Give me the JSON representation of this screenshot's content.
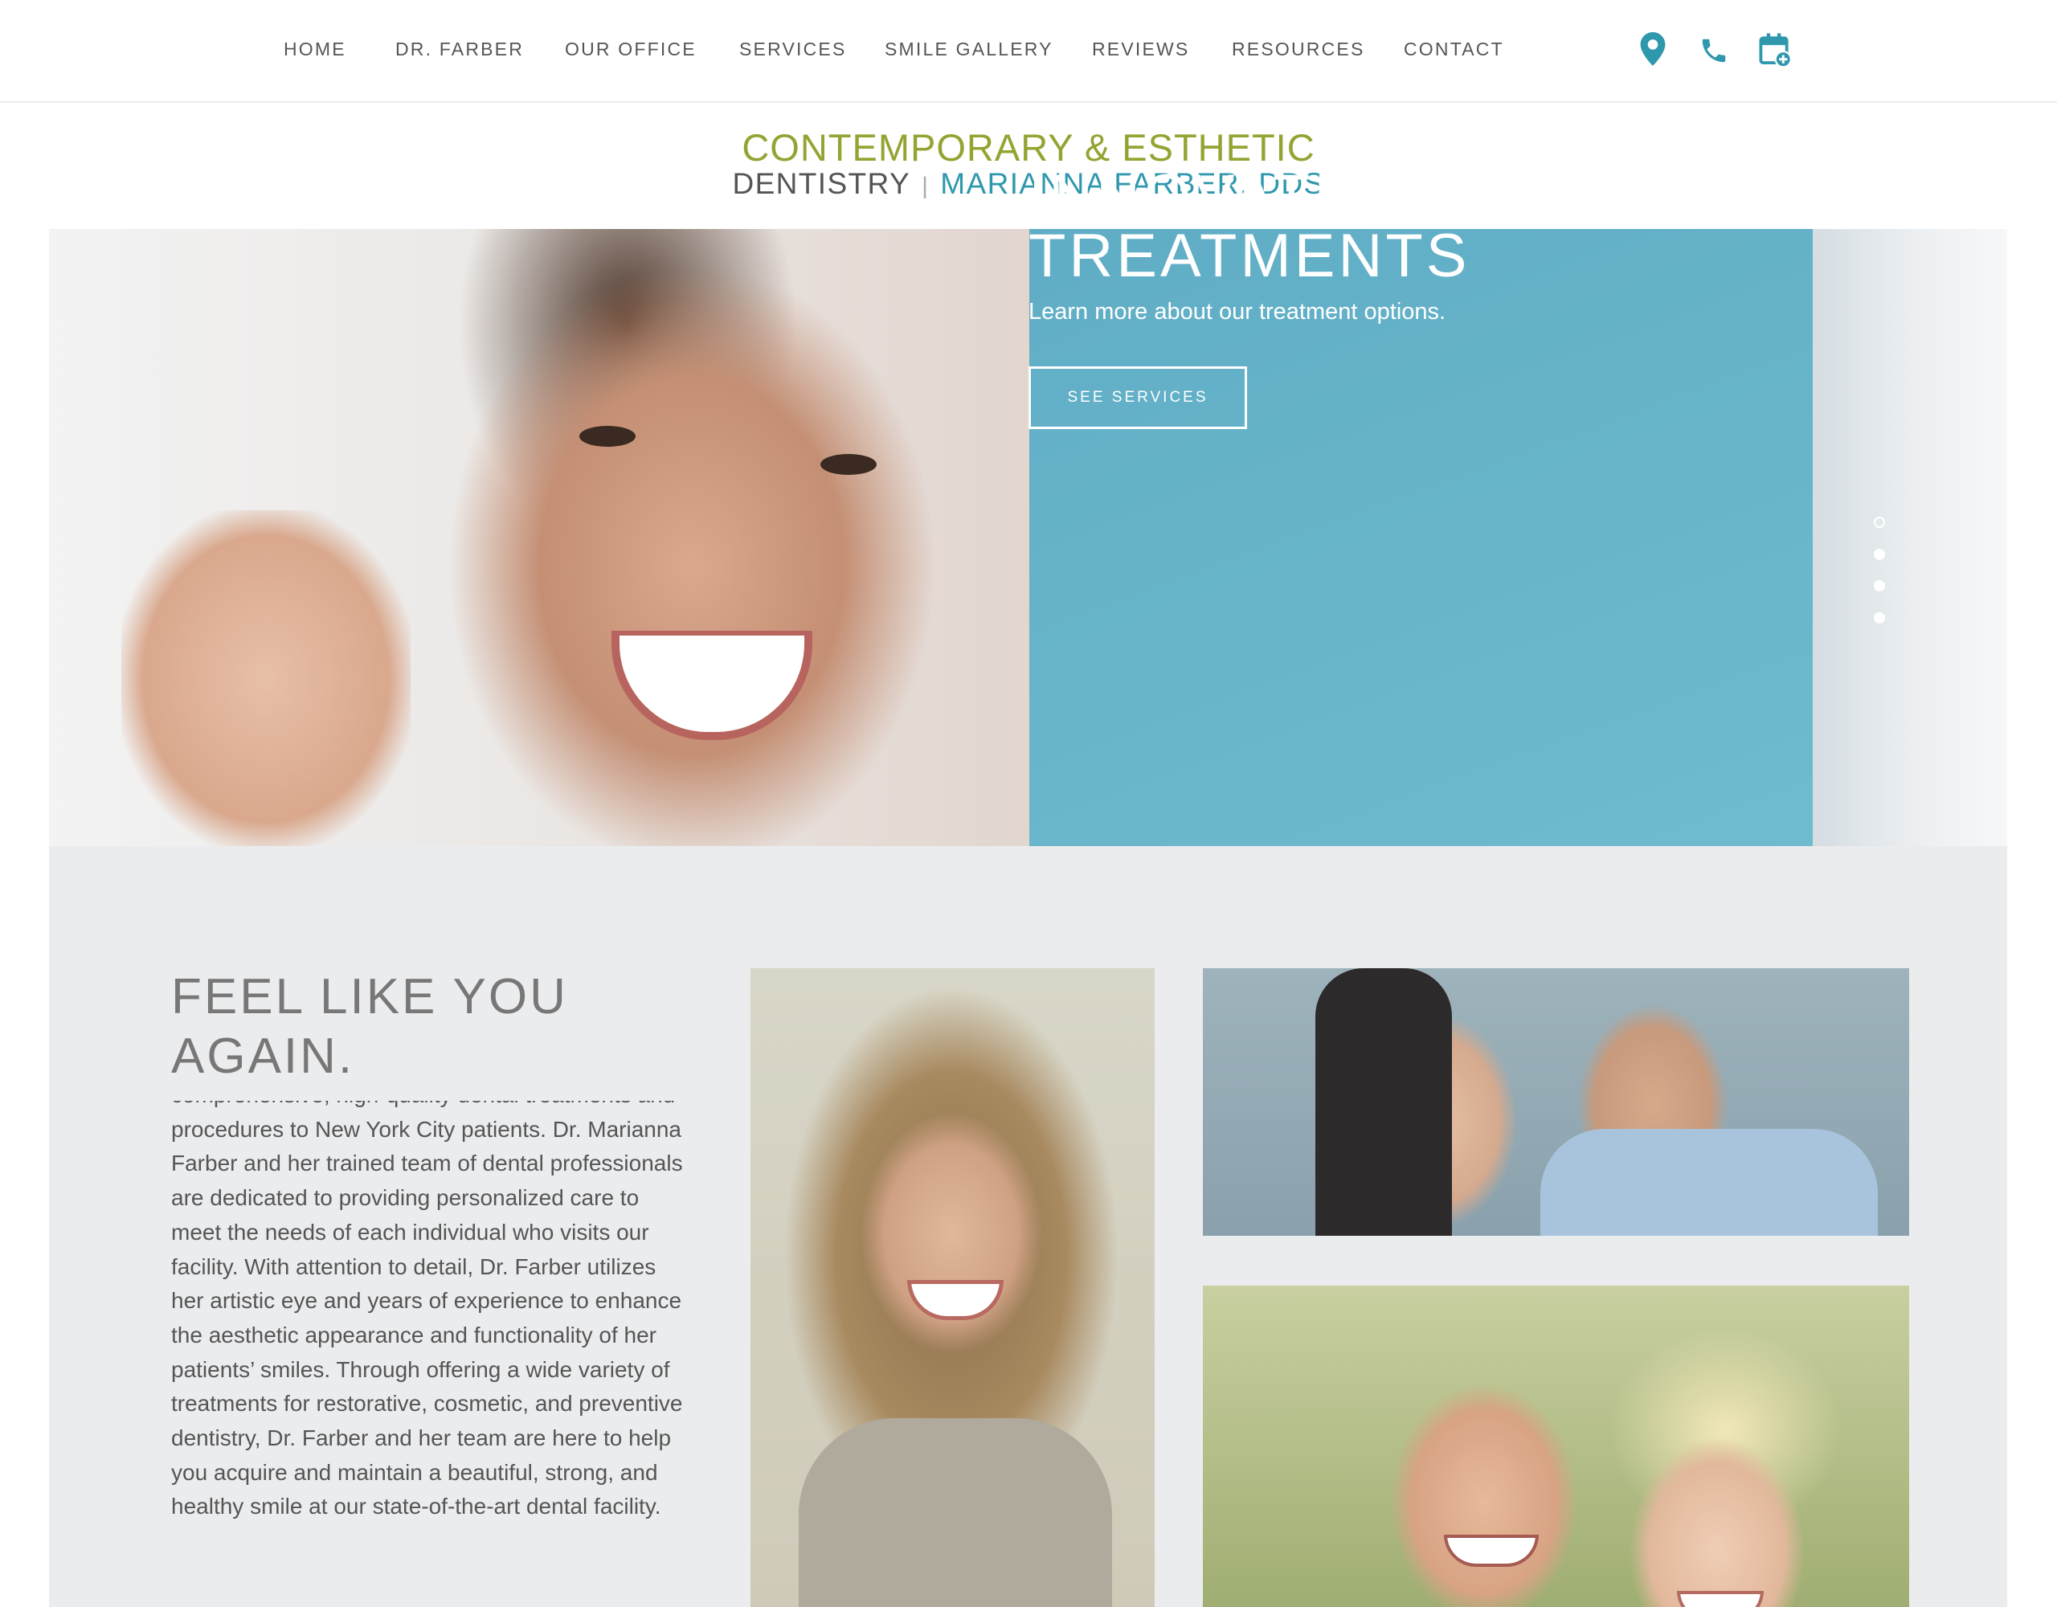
{
  "nav": {
    "items": [
      {
        "label": "HOME"
      },
      {
        "label": "DR. FARBER"
      },
      {
        "label": "OUR OFFICE"
      },
      {
        "label": "SERVICES"
      },
      {
        "label": "SMILE GALLERY"
      },
      {
        "label": "REVIEWS"
      },
      {
        "label": "RESOURCES"
      },
      {
        "label": "CONTACT"
      }
    ],
    "icons": [
      "location-pin-icon",
      "phone-icon",
      "calendar-add-icon"
    ],
    "icon_color": "#2f98ad"
  },
  "logo": {
    "line1": "CONTEMPORARY & ESTHETIC",
    "dentistry": "DENTISTRY",
    "separator": "|",
    "name": "MARIANNA FARBER, DDS",
    "colors": {
      "line1": "#95a332",
      "dentistry": "#555555",
      "name": "#2f98ad"
    }
  },
  "hero": {
    "title": "INNOVATIVE\nTREATMENTS",
    "subtitle": "Learn more about our treatment options.",
    "button_label": "SEE SERVICES",
    "panel_color": "#5eb2ca",
    "slides": 4,
    "active_slide": 1
  },
  "about": {
    "heading": "FEEL LIKE YOU\nAGAIN.",
    "body": "comprehensive, high-quality dental treatments and procedures to New York City patients. Dr. Marianna Farber and her trained team of dental professionals are dedicated to providing personalized care to meet the needs of each individual who visits our facility. With attention to detail, Dr. Farber utilizes her artistic eye and years of experience to enhance the aesthetic appearance and functionality of her patients’ smiles. Through offering a wide variety of treatments for restorative, cosmetic, and preventive dentistry, Dr. Farber and her team are here to help you acquire and maintain a beautiful, strong, and healthy smile at our state-of-the-art dental facility."
  }
}
